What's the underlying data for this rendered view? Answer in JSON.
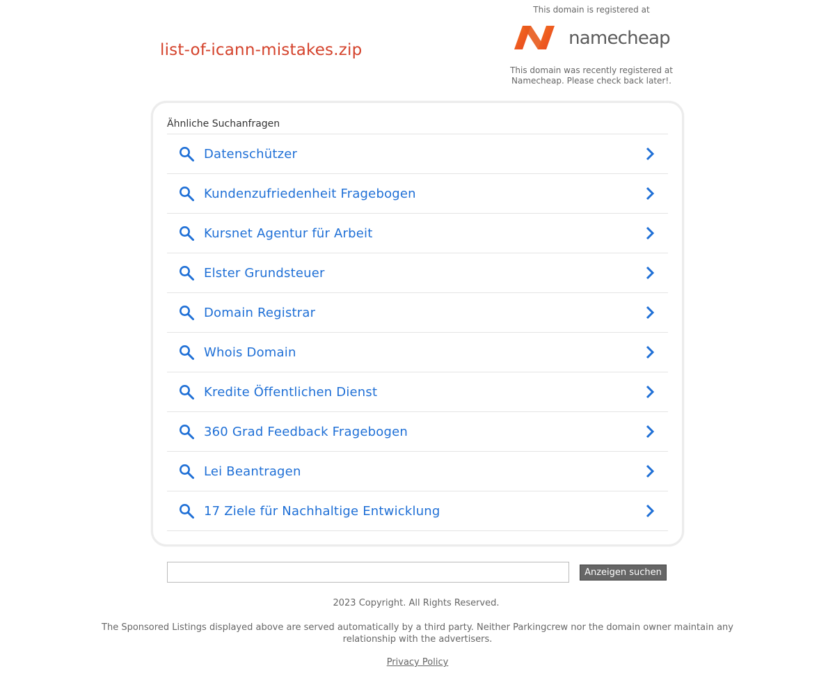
{
  "header": {
    "domain_name": "list-of-icann-mistakes.zip",
    "registered_at_label": "This domain is registered at",
    "registrar_logo_text": "namecheap",
    "registrar_note": "This domain was recently registered at Namecheap. Please check back later!."
  },
  "related": {
    "heading": "Ähnliche Suchanfragen",
    "items": [
      {
        "label": "Datenschützer"
      },
      {
        "label": "Kundenzufriedenheit Fragebogen"
      },
      {
        "label": "Kursnet Agentur für Arbeit"
      },
      {
        "label": "Elster Grundsteuer"
      },
      {
        "label": "Domain Registrar"
      },
      {
        "label": "Whois Domain"
      },
      {
        "label": "Kredite Öffentlichen Dienst"
      },
      {
        "label": "360 Grad Feedback Fragebogen"
      },
      {
        "label": "Lei Beantragen"
      },
      {
        "label": "17 Ziele für Nachhaltige Entwicklung"
      }
    ]
  },
  "search": {
    "input_value": "",
    "button_label": "Anzeigen suchen"
  },
  "footer": {
    "copyright": "2023 Copyright. All Rights Reserved.",
    "disclaimer": "The Sponsored Listings displayed above are served automatically by a third party. Neither Parkingcrew nor the domain owner maintain any relationship with the advertisers.",
    "privacy_link": "Privacy Policy"
  },
  "colors": {
    "domain_title": "#d4422b",
    "link_blue": "#1e6fd6",
    "icon_blue": "#1e6fd6",
    "logo_orange": "#f15a22",
    "button_bg": "#666666"
  },
  "icons": {
    "item_leading": "search-icon",
    "item_trailing": "chevron-right-icon"
  }
}
